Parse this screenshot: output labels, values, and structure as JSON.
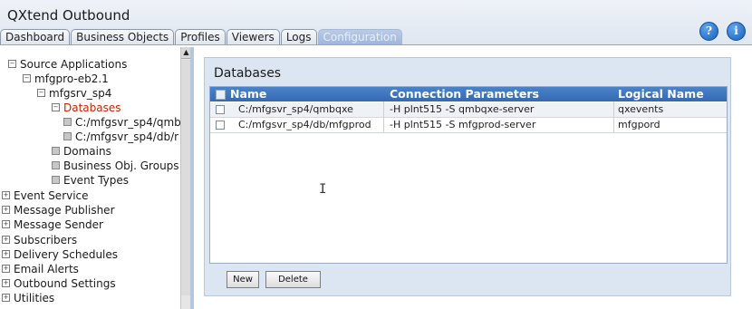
{
  "app": {
    "title": "QXtend Outbound"
  },
  "tabs": [
    {
      "label": "Dashboard"
    },
    {
      "label": "Business Objects"
    },
    {
      "label": "Profiles"
    },
    {
      "label": "Viewers"
    },
    {
      "label": "Logs"
    },
    {
      "label": "Configuration",
      "active": true
    }
  ],
  "header_buttons": {
    "help": "?",
    "info": "i"
  },
  "tree": {
    "items": [
      {
        "label": "Source Applications",
        "marker": "⊟"
      },
      {
        "label": "mfgpro-eb2.1",
        "marker": "⊟"
      },
      {
        "label": "mfgsrv_sp4",
        "marker": "⊟"
      },
      {
        "label": "Databases",
        "marker": "⊟",
        "selected": true
      },
      {
        "label": "C:/mfgsvr_sp4/qmb",
        "marker": "▪"
      },
      {
        "label": "C:/mfgsvr_sp4/db/r",
        "marker": "▪"
      },
      {
        "label": "Domains",
        "marker": "▪"
      },
      {
        "label": "Business Obj. Groups",
        "marker": "▪"
      },
      {
        "label": "Event Types",
        "marker": "▪"
      },
      {
        "label": "Event Service",
        "marker": "⊞"
      },
      {
        "label": "Message Publisher",
        "marker": "⊞"
      },
      {
        "label": "Message Sender",
        "marker": "⊞"
      },
      {
        "label": "Subscribers",
        "marker": "⊞"
      },
      {
        "label": "Delivery Schedules",
        "marker": "⊞"
      },
      {
        "label": "Email Alerts",
        "marker": "⊞"
      },
      {
        "label": "Outbound Settings",
        "marker": "⊞"
      },
      {
        "label": "Utilities",
        "marker": "⊞"
      }
    ]
  },
  "main": {
    "title": "Databases",
    "columns": [
      "Name",
      "Connection Parameters",
      "Logical Name"
    ],
    "rows": [
      {
        "name": "C:/mfgsvr_sp4/qmbqxe",
        "connection": "-H plnt515 -S qmbqxe-server",
        "logical": "qxevents"
      },
      {
        "name": "C:/mfgsvr_sp4/db/mfgprod",
        "connection": "-H plnt515 -S mfgprod-server",
        "logical": "mfgpord"
      }
    ],
    "buttons": {
      "new": "New",
      "delete": "Delete"
    }
  },
  "colors": {
    "header_blue": "#3b72bd",
    "selected_tree": "#cc2200",
    "panel_bg": "#dce6f2"
  }
}
